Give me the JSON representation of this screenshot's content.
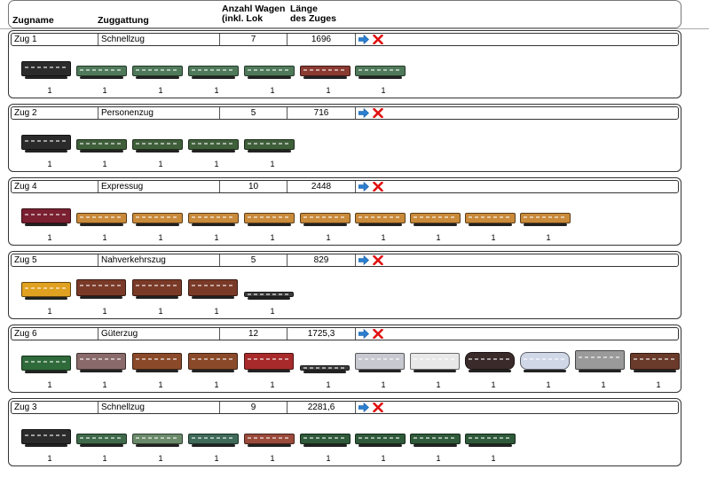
{
  "header": {
    "name": "Zugname",
    "type": "Zuggattung",
    "count_line1": "Anzahl Wagen",
    "count_line2": "(inkl. Lok",
    "length_line1": "Länge",
    "length_line2": "des Zuges"
  },
  "icons": {
    "go": "arrow-right-icon",
    "delete": "red-x-icon"
  },
  "colors": {
    "go_arrow": "#2a7fd0",
    "delete": "#e01010"
  },
  "trains": [
    {
      "name": "Zug 1",
      "type": "Schnellzug",
      "count": "7",
      "length": "1696",
      "vehicles": [
        {
          "kind": "steam-locomotive",
          "color": "#2b2b2b",
          "qty": "1"
        },
        {
          "kind": "passenger-car",
          "color": "#4f7a5a",
          "qty": "1"
        },
        {
          "kind": "passenger-car",
          "color": "#4f7a5a",
          "qty": "1"
        },
        {
          "kind": "passenger-car",
          "color": "#4f7a5a",
          "qty": "1"
        },
        {
          "kind": "passenger-car",
          "color": "#4f7a5a",
          "qty": "1"
        },
        {
          "kind": "dining-car",
          "color": "#8b3a32",
          "qty": "1"
        },
        {
          "kind": "passenger-car",
          "color": "#4f7a5a",
          "qty": "1"
        }
      ]
    },
    {
      "name": "Zug 2",
      "type": "Personenzug",
      "count": "5",
      "length": "716",
      "vehicles": [
        {
          "kind": "steam-locomotive",
          "color": "#2b2b2b",
          "qty": "1"
        },
        {
          "kind": "passenger-car",
          "color": "#3f5f3a",
          "qty": "1"
        },
        {
          "kind": "passenger-car",
          "color": "#3f5f3a",
          "qty": "1"
        },
        {
          "kind": "passenger-car",
          "color": "#3f5f3a",
          "qty": "1"
        },
        {
          "kind": "baggage-car",
          "color": "#3f5f3a",
          "qty": "1"
        }
      ]
    },
    {
      "name": "Zug 4",
      "type": "Expressug",
      "count": "10",
      "length": "2448",
      "vehicles": [
        {
          "kind": "diesel-locomotive",
          "color": "#7a2030",
          "qty": "1"
        },
        {
          "kind": "passenger-car",
          "color": "#c98a3a",
          "qty": "1"
        },
        {
          "kind": "passenger-car",
          "color": "#c98a3a",
          "qty": "1"
        },
        {
          "kind": "passenger-car",
          "color": "#c98a3a",
          "qty": "1"
        },
        {
          "kind": "passenger-car",
          "color": "#c98a3a",
          "qty": "1"
        },
        {
          "kind": "passenger-car",
          "color": "#c98a3a",
          "qty": "1"
        },
        {
          "kind": "passenger-car",
          "color": "#c98a3a",
          "qty": "1"
        },
        {
          "kind": "passenger-car",
          "color": "#c98a3a",
          "qty": "1"
        },
        {
          "kind": "passenger-car",
          "color": "#c98a3a",
          "qty": "1"
        },
        {
          "kind": "passenger-car",
          "color": "#c98a3a",
          "qty": "1"
        }
      ]
    },
    {
      "name": "Zug 5",
      "type": "Nahverkehrszug",
      "count": "5",
      "length": "829",
      "vehicles": [
        {
          "kind": "diesel-locomotive",
          "color": "#e0a020",
          "qty": "1"
        },
        {
          "kind": "freight-car",
          "color": "#7a3a28",
          "qty": "1"
        },
        {
          "kind": "freight-car",
          "color": "#7a3a28",
          "qty": "1"
        },
        {
          "kind": "freight-car",
          "color": "#7a3a28",
          "qty": "1"
        },
        {
          "kind": "flat-car",
          "color": "#3a3a3a",
          "qty": "1"
        }
      ]
    },
    {
      "name": "Zug 6",
      "type": "Güterzug",
      "count": "12",
      "length": "1725,3",
      "vehicles": [
        {
          "kind": "electric-locomotive",
          "color": "#2f6a3a",
          "qty": "1"
        },
        {
          "kind": "freight-car",
          "color": "#8a6a6a",
          "qty": "1"
        },
        {
          "kind": "freight-car",
          "color": "#8a4a2a",
          "qty": "1"
        },
        {
          "kind": "freight-car",
          "color": "#8a4a2a",
          "qty": "1"
        },
        {
          "kind": "freight-car",
          "color": "#a82a2a",
          "qty": "1"
        },
        {
          "kind": "flat-car",
          "color": "#3a3a3a",
          "qty": "1"
        },
        {
          "kind": "freight-car",
          "color": "#c8c8d0",
          "qty": "1"
        },
        {
          "kind": "freight-car",
          "color": "#e8e8e8",
          "qty": "1"
        },
        {
          "kind": "tank-car",
          "color": "#3a2a2a",
          "qty": "1"
        },
        {
          "kind": "tank-car",
          "color": "#d0d8e8",
          "qty": "1"
        },
        {
          "kind": "hopper-car",
          "color": "#9a9a9a",
          "qty": "1"
        },
        {
          "kind": "freight-car",
          "color": "#6a3a2a",
          "qty": "1"
        }
      ]
    },
    {
      "name": "Zug 3",
      "type": "Schnellzug",
      "count": "9",
      "length": "2281,6",
      "vehicles": [
        {
          "kind": "steam-locomotive",
          "color": "#2b2b2b",
          "qty": "1"
        },
        {
          "kind": "passenger-car",
          "color": "#3f6a4a",
          "qty": "1"
        },
        {
          "kind": "passenger-car",
          "color": "#6a8a6a",
          "qty": "1"
        },
        {
          "kind": "passenger-car",
          "color": "#3f6a5a",
          "qty": "1"
        },
        {
          "kind": "dining-car",
          "color": "#9a4a3a",
          "qty": "1"
        },
        {
          "kind": "passenger-car",
          "color": "#2f5a3a",
          "qty": "1"
        },
        {
          "kind": "passenger-car",
          "color": "#2f5a3a",
          "qty": "1"
        },
        {
          "kind": "passenger-car",
          "color": "#2f5a3a",
          "qty": "1"
        },
        {
          "kind": "passenger-car",
          "color": "#2f5a3a",
          "qty": "1"
        }
      ]
    }
  ]
}
